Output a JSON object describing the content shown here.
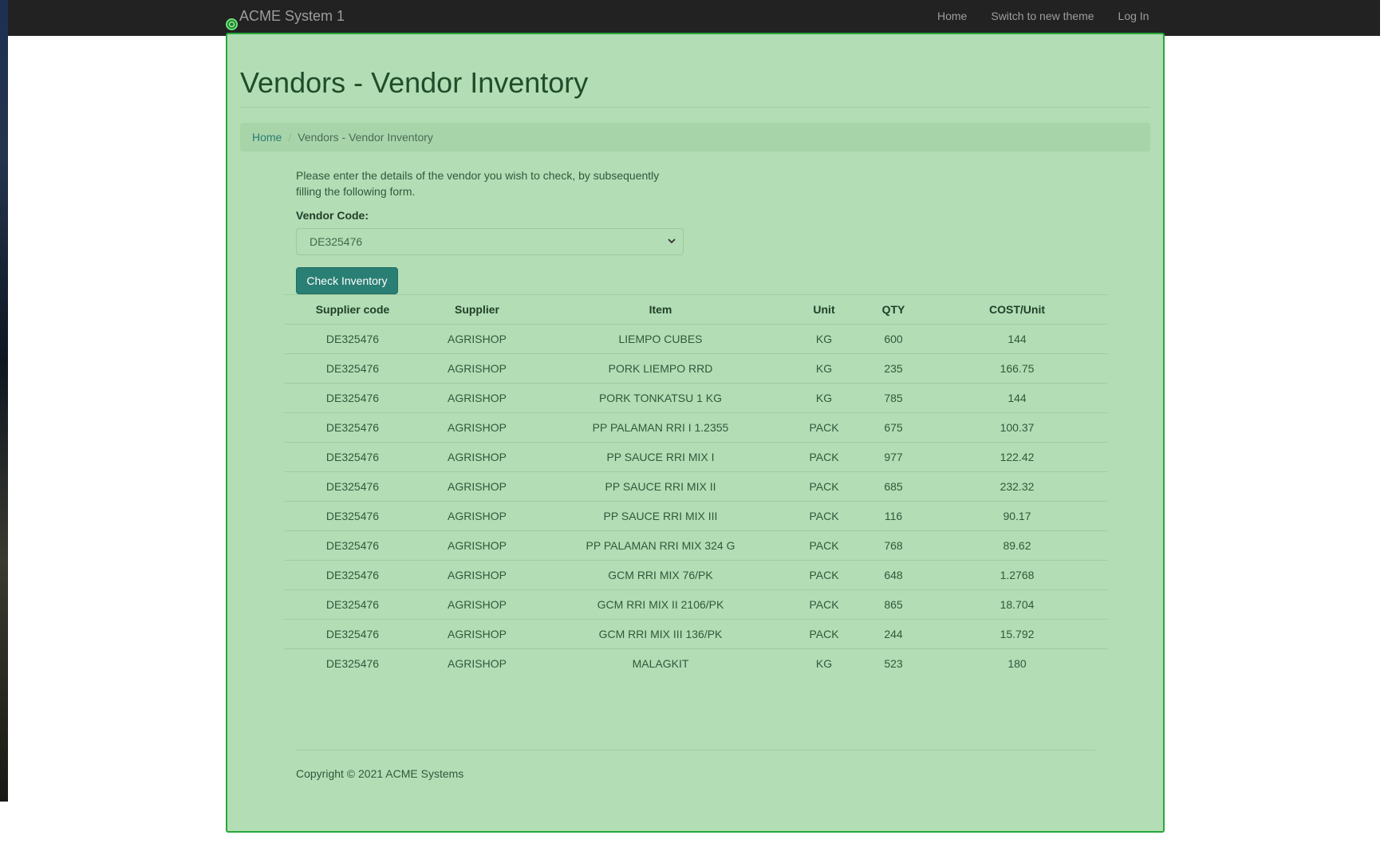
{
  "navbar": {
    "brand": "ACME System 1",
    "links": [
      "Home",
      "Switch to new theme",
      "Log In"
    ]
  },
  "page": {
    "title": "Vendors - Vendor Inventory",
    "breadcrumb": {
      "home": "Home",
      "current": "Vendors - Vendor Inventory"
    },
    "intro": "Please enter the details of the vendor you wish to check, by subsequently filling the following form.",
    "vendor_label": "Vendor Code:",
    "vendor_value": "DE325476",
    "check_button": "Check Inventory"
  },
  "table": {
    "headers": [
      "Supplier code",
      "Supplier",
      "Item",
      "Unit",
      "QTY",
      "COST/Unit"
    ],
    "rows": [
      [
        "DE325476",
        "AGRISHOP",
        "LIEMPO CUBES",
        "KG",
        "600",
        "144"
      ],
      [
        "DE325476",
        "AGRISHOP",
        "PORK LIEMPO RRD",
        "KG",
        "235",
        "166.75"
      ],
      [
        "DE325476",
        "AGRISHOP",
        "PORK TONKATSU 1 KG",
        "KG",
        "785",
        "144"
      ],
      [
        "DE325476",
        "AGRISHOP",
        "PP PALAMAN RRI I 1.2355",
        "PACK",
        "675",
        "100.37"
      ],
      [
        "DE325476",
        "AGRISHOP",
        "PP SAUCE RRI MIX I",
        "PACK",
        "977",
        "122.42"
      ],
      [
        "DE325476",
        "AGRISHOP",
        "PP SAUCE RRI MIX II",
        "PACK",
        "685",
        "232.32"
      ],
      [
        "DE325476",
        "AGRISHOP",
        "PP SAUCE RRI MIX III",
        "PACK",
        "116",
        "90.17"
      ],
      [
        "DE325476",
        "AGRISHOP",
        "PP PALAMAN RRI MIX 324 G",
        "PACK",
        "768",
        "89.62"
      ],
      [
        "DE325476",
        "AGRISHOP",
        "GCM RRI MIX 76/PK",
        "PACK",
        "648",
        "1.2768"
      ],
      [
        "DE325476",
        "AGRISHOP",
        "GCM RRI MIX II 2106/PK",
        "PACK",
        "865",
        "18.704"
      ],
      [
        "DE325476",
        "AGRISHOP",
        "GCM RRI MIX III 136/PK",
        "PACK",
        "244",
        "15.792"
      ],
      [
        "DE325476",
        "AGRISHOP",
        "MALAGKIT",
        "KG",
        "523",
        "180"
      ]
    ]
  },
  "footer": {
    "copyright": "Copyright © 2021 ACME Systems"
  }
}
